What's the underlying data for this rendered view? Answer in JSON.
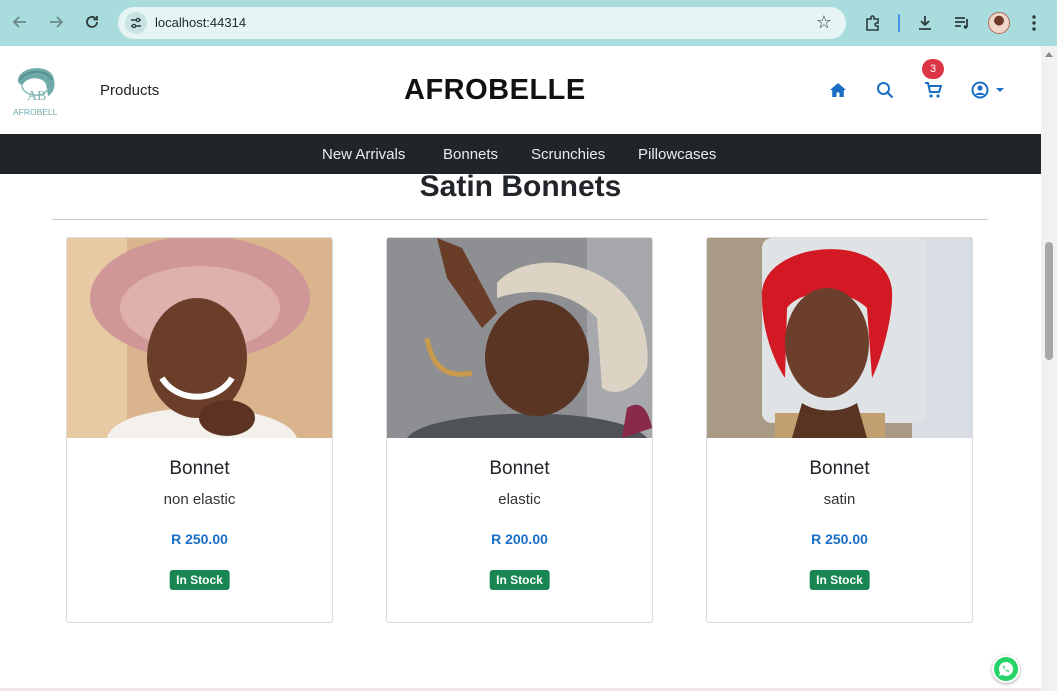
{
  "browser": {
    "url": "localhost:44314",
    "icons": [
      "back-icon",
      "forward-icon",
      "reload-icon",
      "site-info-icon",
      "bookmark-star-icon",
      "extensions-icon",
      "download-icon",
      "media-queue-icon",
      "profile-avatar",
      "kebab-menu-icon"
    ]
  },
  "header": {
    "logo_text": "AB",
    "logo_subtext": "AFROBELLE",
    "products_label": "Products",
    "brand": "AFROBELLE",
    "cart_count": "3",
    "accent_color": "#1a6fc4",
    "badge_color": "#dc3545"
  },
  "nav": {
    "items": [
      "New Arrivals",
      "Bonnets",
      "Scrunchies",
      "Pillowcases"
    ]
  },
  "main": {
    "title": "Satin Bonnets",
    "products": [
      {
        "name": "Bonnet",
        "desc": "non elastic",
        "price": "R 250.00",
        "stock": "In Stock",
        "bonnet_color": "#d9a3a3"
      },
      {
        "name": "Bonnet",
        "desc": "elastic",
        "price": "R 200.00",
        "stock": "In Stock",
        "bonnet_color": "#ddd3c4"
      },
      {
        "name": "Bonnet",
        "desc": "satin",
        "price": "R 250.00",
        "stock": "In Stock",
        "bonnet_color": "#d31a24"
      }
    ],
    "stock_color": "#198754"
  }
}
